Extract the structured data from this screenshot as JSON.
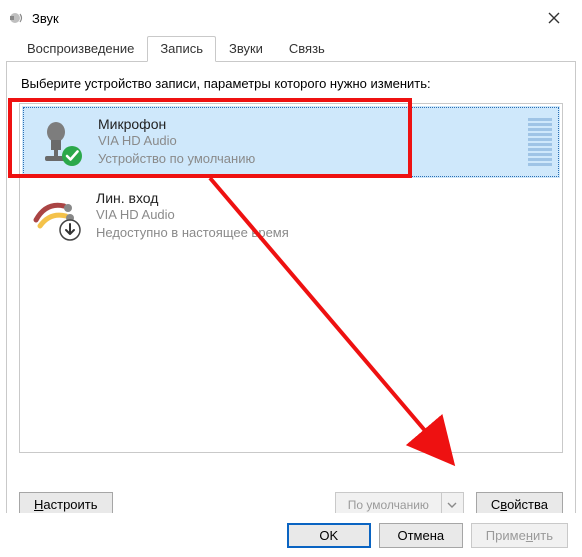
{
  "window": {
    "title": "Звук"
  },
  "tabs": {
    "items": [
      {
        "label": "Воспроизведение"
      },
      {
        "label": "Запись"
      },
      {
        "label": "Звуки"
      },
      {
        "label": "Связь"
      }
    ],
    "active_index": 1
  },
  "panel": {
    "instruction": "Выберите устройство записи, параметры которого нужно изменить:"
  },
  "devices": [
    {
      "name": "Микрофон",
      "driver": "VIA HD Audio",
      "state": "Устройство по умолчанию",
      "selected": true,
      "status_overlay": "default-check"
    },
    {
      "name": "Лин. вход",
      "driver": "VIA HD Audio",
      "state": "Недоступно в настоящее время",
      "selected": false,
      "status_overlay": "disabled-arrow"
    }
  ],
  "panel_buttons": {
    "configure": "Настроить",
    "default_dropdown": "По умолчанию",
    "properties": "Свойства"
  },
  "footer": {
    "ok": "OK",
    "cancel": "Отмена",
    "apply": "Применить"
  },
  "annotation": {
    "color": "#e11",
    "arrow_from": "device-0",
    "arrow_to": "properties-button"
  }
}
